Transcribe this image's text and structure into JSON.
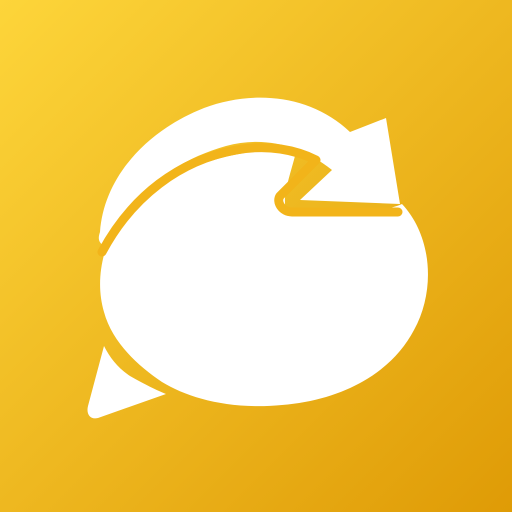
{
  "icon": {
    "name": "chat-refresh-app-icon",
    "glyph": "speech-bubble-with-circular-arrow",
    "colors": {
      "background_top_left": "#fdd53a",
      "background_bottom_right": "#df9b06",
      "glyph": "#ffffff",
      "outline": "#f2b41a"
    }
  }
}
